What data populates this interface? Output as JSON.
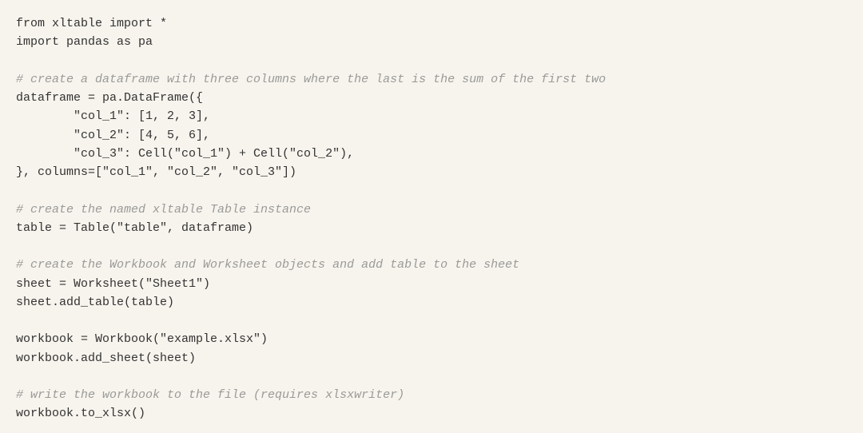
{
  "code": {
    "lines": [
      {
        "text": "from xltable import *",
        "comment": false
      },
      {
        "text": "import pandas as pa",
        "comment": false
      },
      {
        "text": "",
        "comment": false
      },
      {
        "text": "# create a dataframe with three columns where the last is the sum of the first two",
        "comment": true
      },
      {
        "text": "dataframe = pa.DataFrame({",
        "comment": false
      },
      {
        "text": "        \"col_1\": [1, 2, 3],",
        "comment": false
      },
      {
        "text": "        \"col_2\": [4, 5, 6],",
        "comment": false
      },
      {
        "text": "        \"col_3\": Cell(\"col_1\") + Cell(\"col_2\"),",
        "comment": false
      },
      {
        "text": "}, columns=[\"col_1\", \"col_2\", \"col_3\"])",
        "comment": false
      },
      {
        "text": "",
        "comment": false
      },
      {
        "text": "# create the named xltable Table instance",
        "comment": true
      },
      {
        "text": "table = Table(\"table\", dataframe)",
        "comment": false
      },
      {
        "text": "",
        "comment": false
      },
      {
        "text": "# create the Workbook and Worksheet objects and add table to the sheet",
        "comment": true
      },
      {
        "text": "sheet = Worksheet(\"Sheet1\")",
        "comment": false
      },
      {
        "text": "sheet.add_table(table)",
        "comment": false
      },
      {
        "text": "",
        "comment": false
      },
      {
        "text": "workbook = Workbook(\"example.xlsx\")",
        "comment": false
      },
      {
        "text": "workbook.add_sheet(sheet)",
        "comment": false
      },
      {
        "text": "",
        "comment": false
      },
      {
        "text": "# write the workbook to the file (requires xlsxwriter)",
        "comment": true
      },
      {
        "text": "workbook.to_xlsx()",
        "comment": false
      }
    ]
  }
}
